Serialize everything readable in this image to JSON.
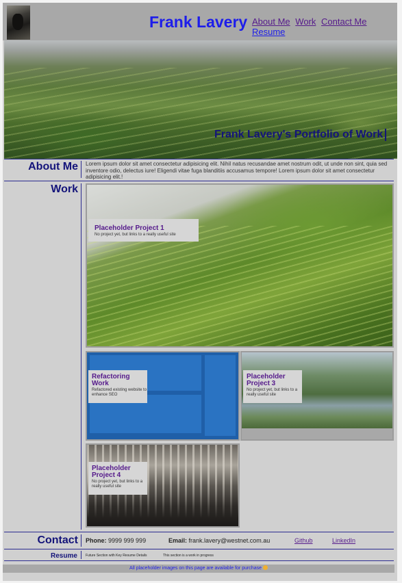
{
  "header": {
    "title": "Frank Lavery",
    "nav": [
      "About Me",
      "Work",
      "Contact Me",
      "Resume"
    ]
  },
  "hero": {
    "caption": "Frank Lavery's Portfolio of Work"
  },
  "about": {
    "title": "About Me",
    "text": "Lorem ipsum dolor sit amet consectetur adipisicing elit. Nihil natus recusandae amet nostrum odit, ut unde non sint, quia sed inventore odio, delectus iure! Eligendi vitae fuga blanditiis accusamus tempore! Lorem ipsum dolor sit amet consectetur adipisicing elit.!"
  },
  "work": {
    "title": "Work",
    "projects": [
      {
        "name": "Placeholder Project 1",
        "desc": "No project yet, but links to a really useful site"
      },
      {
        "name": "Refactoring Work",
        "desc": "Refactored existing website to enhance SEO"
      },
      {
        "name": "Placeholder Project 3",
        "desc": "No project yet, but links to a really useful site"
      },
      {
        "name": "Placeholder Project 4",
        "desc": "No project yet, but links to a really useful site"
      }
    ]
  },
  "contact": {
    "title": "Contact",
    "phone_label": "Phone:",
    "phone": "9999 999 999",
    "email_label": "Email:",
    "email": "frank.lavery@westnet.com.au",
    "github": "Github",
    "linkedin": "LinkedIn"
  },
  "resume": {
    "title": "Resume",
    "note1": "Future Section with Key Resume Details",
    "note2": "This section is a work in progress"
  },
  "footer": {
    "text": "All placeholder images on this page are available for purchase"
  },
  "colors": {
    "accent": "#1d1dea",
    "heading": "#14147a",
    "visited_link": "#551a8b",
    "bar": "#a8a8a8",
    "panel": "#d0d0d0"
  }
}
